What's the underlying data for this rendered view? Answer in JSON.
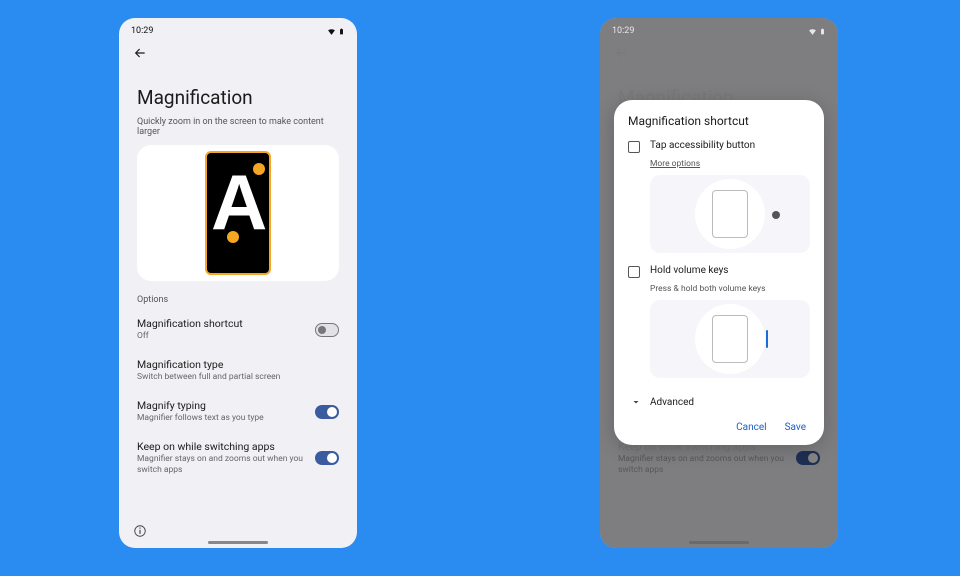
{
  "status": {
    "time": "10:29"
  },
  "left": {
    "title": "Magnification",
    "subtitle": "Quickly zoom in on the screen to make content larger",
    "optionsLabel": "Options",
    "rows": {
      "shortcut": {
        "title": "Magnification shortcut",
        "sub": "Off"
      },
      "type": {
        "title": "Magnification type",
        "sub": "Switch between full and partial screen"
      },
      "typing": {
        "title": "Magnify typing",
        "sub": "Magnifier follows text as you type"
      },
      "keep": {
        "title": "Keep on while switching apps",
        "sub": "Magnifier stays on and zooms out when you switch apps"
      }
    }
  },
  "dialog": {
    "title": "Magnification shortcut",
    "opt1": {
      "label": "Tap accessibility button",
      "more": "More options"
    },
    "opt2": {
      "label": "Hold volume keys",
      "desc": "Press & hold both volume keys"
    },
    "advanced": "Advanced",
    "cancel": "Cancel",
    "save": "Save"
  }
}
